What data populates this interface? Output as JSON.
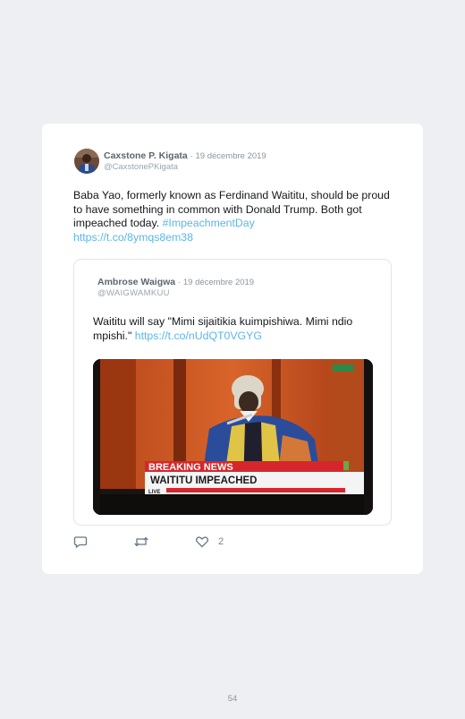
{
  "tweet": {
    "author_name": "Caxstone P. Kigata",
    "date": "· 19 décembre 2019",
    "handle": "@CaxstonePKigata",
    "text_main": "Baba Yao, formerly known as Ferdinand Waititu, should be proud to have something in common with Donald Trump. Both got impeached today. ",
    "hashtag": "#ImpeachmentDay",
    "link": "https://t.co/8ymqs8em38"
  },
  "quoted_tweet": {
    "author_name": "Ambrose Waigwa",
    "date": "· 19 décembre 2019",
    "handle": "@WAIGWAMKUU",
    "text_main": "Waititu will say \"Mimi sijaitikia kuimpishiwa. Mimi ndio mpishi.\" ",
    "link": "https://t.co/nUdQT0VGYG",
    "media": {
      "banner_top": "BREAKING NEWS",
      "banner_main": "WAITITU IMPEACHED",
      "banner_live": "LIVE"
    }
  },
  "actions": {
    "reply_icon": "speech-bubble-icon",
    "retweet_icon": "retweet-icon",
    "like_icon": "heart-icon",
    "like_count": "2"
  },
  "footer": {
    "page_number": "54"
  },
  "colors": {
    "background": "#edeff2",
    "card": "#ffffff",
    "link": "#5cb5e8",
    "banner_red": "#d7262b"
  }
}
